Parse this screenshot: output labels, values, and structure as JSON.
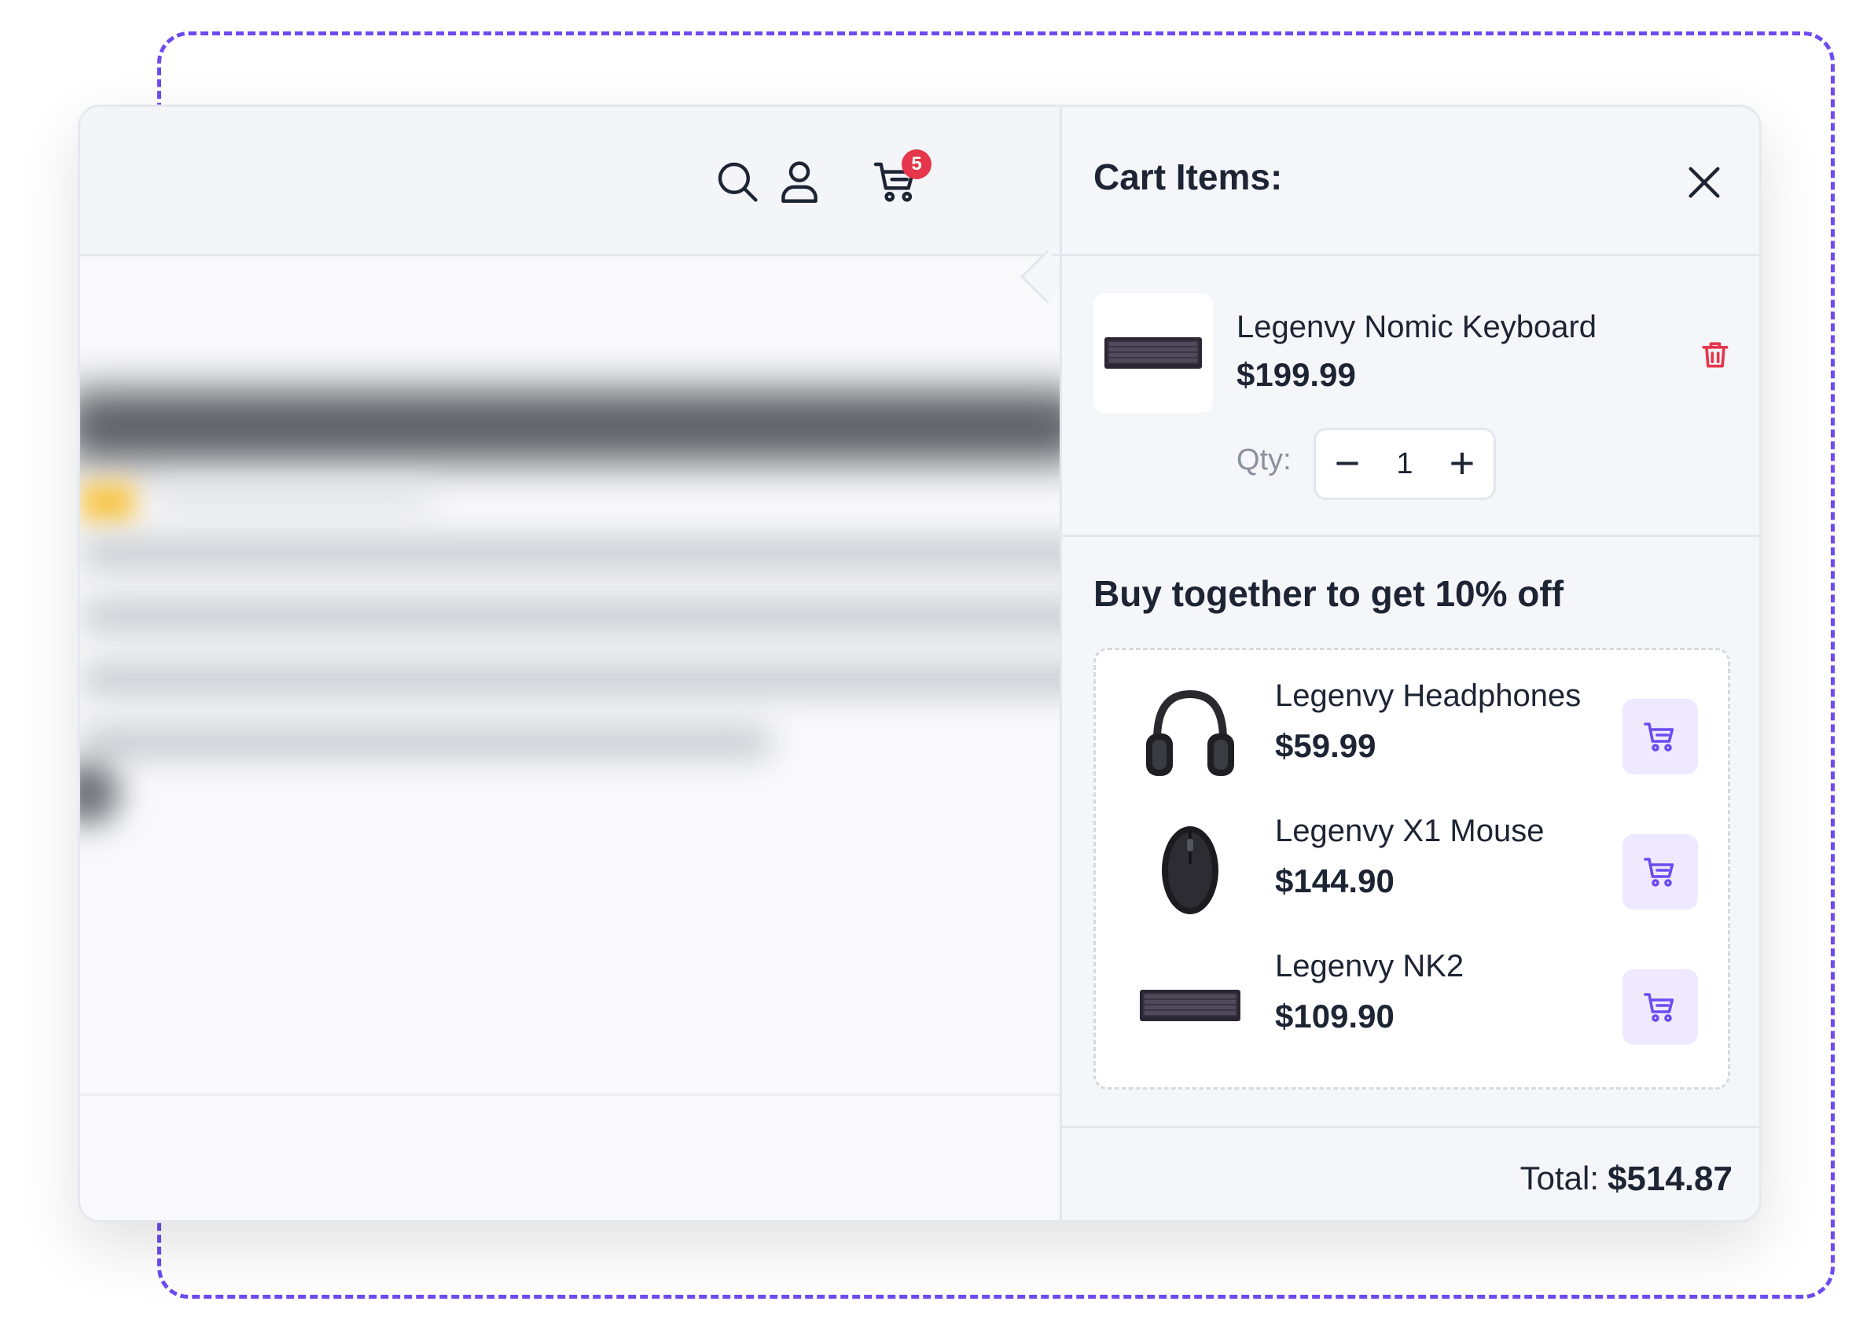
{
  "header": {
    "icons": [
      "search-icon",
      "user-icon",
      "cart-icon"
    ],
    "cart_count": "5"
  },
  "cart": {
    "title": "Cart Items:",
    "item": {
      "name": "Legenvy Nomic Keyboard",
      "price": "$199.99",
      "qty_label": "Qty:",
      "qty_value": "1",
      "minus": "−",
      "plus": "+"
    }
  },
  "bundle": {
    "title": "Buy together to get 10% off",
    "items": [
      {
        "name": "Legenvy Headphones",
        "price": "$59.99",
        "icon": "headphones-image"
      },
      {
        "name": "Legenvy X1 Mouse",
        "price": "$144.90",
        "icon": "mouse-image"
      },
      {
        "name": "Legenvy NK2",
        "price": "$109.90",
        "icon": "keyboard-image"
      }
    ]
  },
  "footer": {
    "total_label": "Total:",
    "total_value": "$514.87"
  },
  "colors": {
    "accent": "#6d4bf0",
    "badge": "#e5364b",
    "add_button_bg": "#efe9ff",
    "delete": "#e5364b"
  }
}
